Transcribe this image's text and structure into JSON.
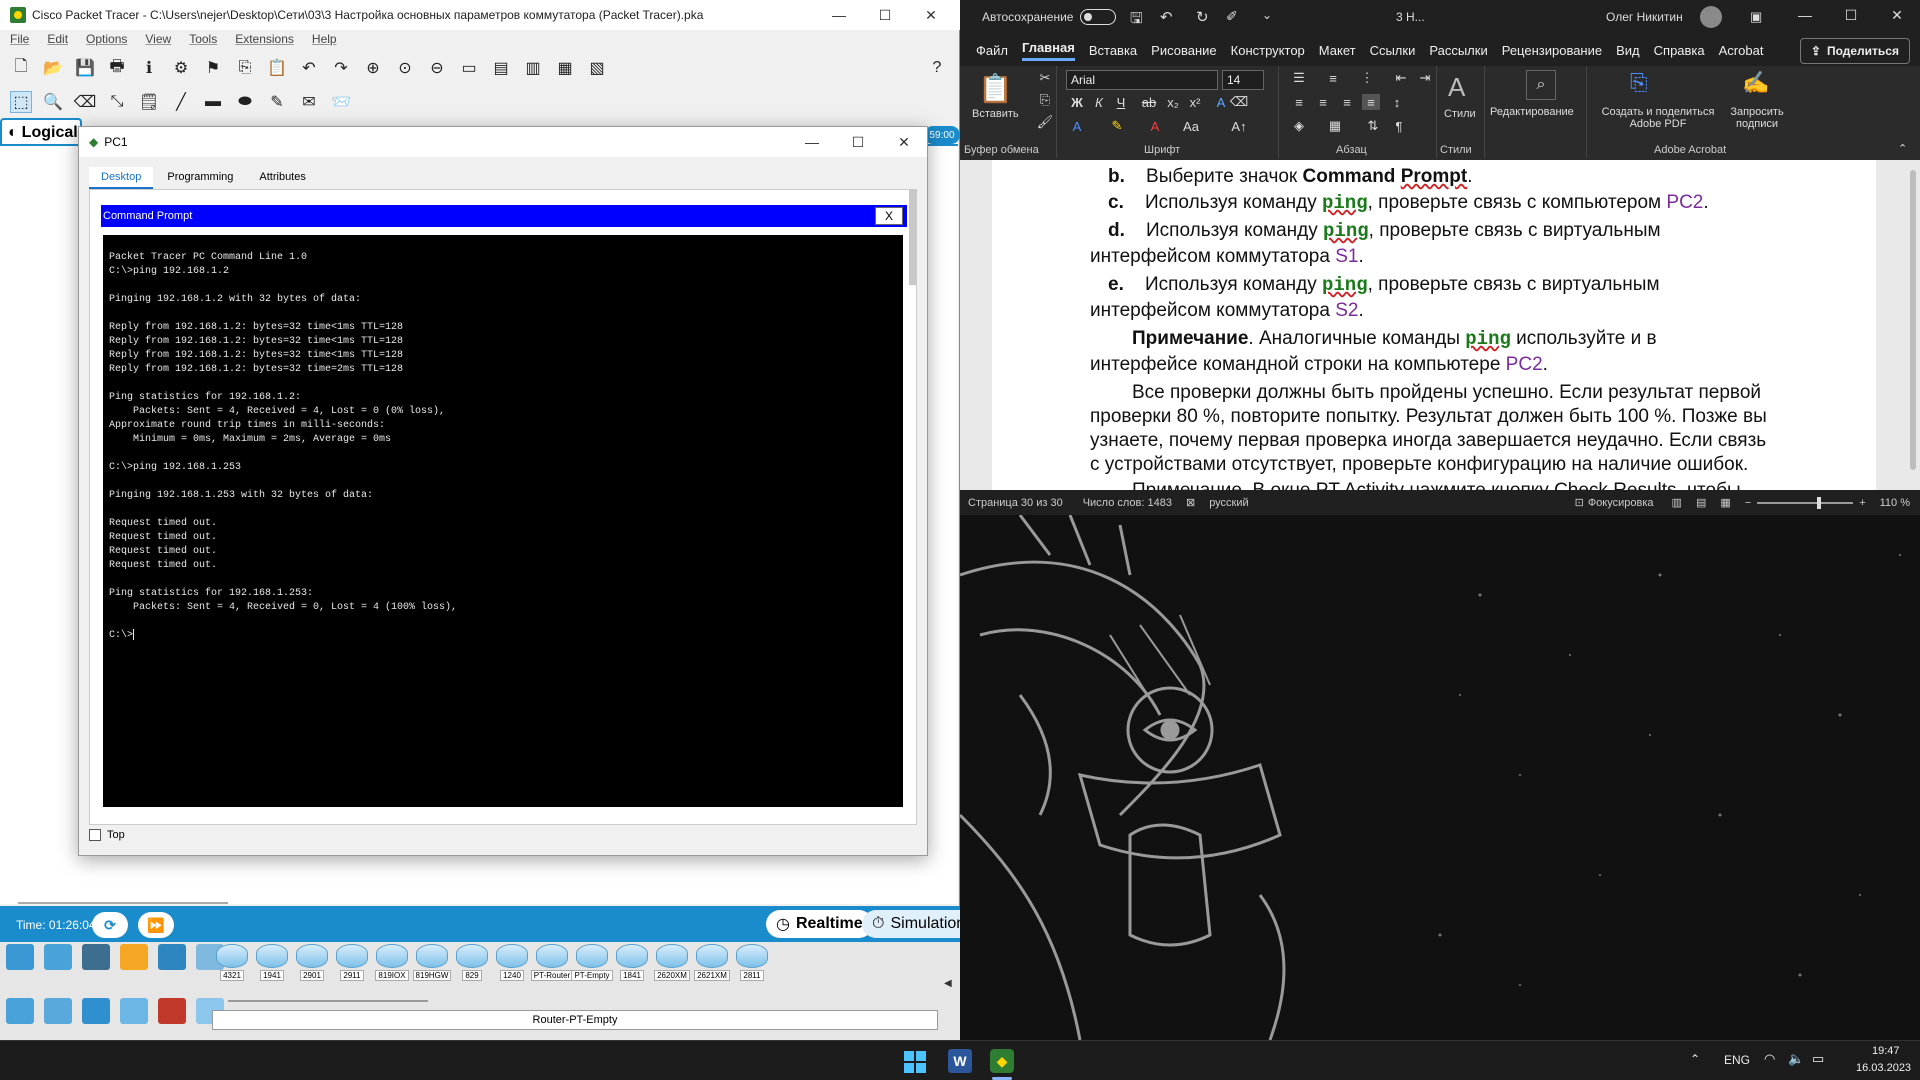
{
  "packet_tracer": {
    "window_title": "Cisco Packet Tracer - C:\\Users\\nejer\\Desktop\\Сети\\03\\3 Настройка основных параметров коммутатора (Packet Tracer).pka",
    "menu": [
      "File",
      "Edit",
      "Options",
      "View",
      "Tools",
      "Extensions",
      "Help"
    ],
    "logical_tab": "Logical",
    "top_right_time": "59:00",
    "time_label": "Time: 01:26:04",
    "realtime_label": "Realtime",
    "simulation_label": "Simulation",
    "device_models": [
      "4321",
      "1941",
      "2901",
      "2911",
      "819IOX",
      "819HGW",
      "829",
      "1240",
      "PT-Router",
      "PT-Empty",
      "1841",
      "2620XM",
      "2621XM",
      "2811"
    ],
    "selected_device": "Router-PT-Empty"
  },
  "pc1": {
    "window_title": "PC1",
    "tabs": [
      "Desktop",
      "Programming",
      "Attributes"
    ],
    "cmd_title": "Command Prompt",
    "cmd_close": "X",
    "terminal_text": "Packet Tracer PC Command Line 1.0\nC:\\>ping 192.168.1.2\n\nPinging 192.168.1.2 with 32 bytes of data:\n\nReply from 192.168.1.2: bytes=32 time<1ms TTL=128\nReply from 192.168.1.2: bytes=32 time<1ms TTL=128\nReply from 192.168.1.2: bytes=32 time<1ms TTL=128\nReply from 192.168.1.2: bytes=32 time=2ms TTL=128\n\nPing statistics for 192.168.1.2:\n    Packets: Sent = 4, Received = 4, Lost = 0 (0% loss),\nApproximate round trip times in milli-seconds:\n    Minimum = 0ms, Maximum = 2ms, Average = 0ms\n\nC:\\>ping 192.168.1.253\n\nPinging 192.168.1.253 with 32 bytes of data:\n\nRequest timed out.\nRequest timed out.\nRequest timed out.\nRequest timed out.\n\nPing statistics for 192.168.1.253:\n    Packets: Sent = 4, Received = 0, Lost = 4 (100% loss),\n\nC:\\>",
    "top_checkbox_label": "Top"
  },
  "word": {
    "autosave_label": "Автосохранение",
    "doc_name": "3 Н...",
    "user_name": "Олег Никитин",
    "tabs": [
      "Файл",
      "Главная",
      "Вставка",
      "Рисование",
      "Конструктор",
      "Макет",
      "Ссылки",
      "Рассылки",
      "Рецензирование",
      "Вид",
      "Справка",
      "Acrobat"
    ],
    "active_tab": "Главная",
    "share_label": "Поделиться",
    "ribbon": {
      "paste_label": "Вставить",
      "font_name": "Arial",
      "font_size": "14",
      "styles_label": "Стили",
      "editing_label": "Редактирование",
      "acrobat_create_label": "Создать и поделиться Adobe PDF",
      "acrobat_sign_label": "Запросить подписи",
      "groups": {
        "clipboard": "Буфер обмена",
        "font": "Шрифт",
        "paragraph": "Абзац",
        "styles": "Стили",
        "acrobat": "Adobe Acrobat"
      }
    },
    "doc": {
      "b_marker": "b.",
      "b_text_pre": "Выберите значок ",
      "b_text_bold1": "Command ",
      "b_text_bold2": "Prompt",
      "b_text_post": ".",
      "c_marker": "c.",
      "c_pre": "Используя команду ",
      "ping": "ping",
      "c_mid": ", проверьте связь с компьютером ",
      "c_term": "PC2",
      "c_post": ".",
      "d_marker": "d.",
      "d_pre": "Используя команду ",
      "d_mid": ", проверьте связь с виртуальным",
      "d_line2": "интерфейсом коммутатора ",
      "d_term": "S1",
      "d_post": ".",
      "e_marker": "e.",
      "e_pre": "Используя команду ",
      "e_mid": ", проверьте связь с виртуальным",
      "e_line2": "интерфейсом коммутатора ",
      "e_term": "S2",
      "e_post": ".",
      "note_label": "Примечание",
      "note_text": ". Аналогичные команды ",
      "note_text2": " используйте и в",
      "note_line2": "интерфейсе командной строки на компьютере ",
      "note_term": "PC2",
      "note_post": ".",
      "para_line1": "Все проверки должны быть пройдены успешно. Если результат первой",
      "para_line2": "проверки 80 %, повторите попытку. Результат должен быть 100 %. Позже вы",
      "para_line3": "узнаете, почему первая проверка иногда завершается неудачно. Если связь",
      "para_line4": "с устройствами отсутствует, проверьте конфигурацию на наличие ошибок.",
      "cut_line": "Примечание. В окне PT Activity нажмите кнопку Check Results, чтобы"
    },
    "status": {
      "page": "Страница 30 из 30",
      "words": "Число слов: 1483",
      "language": "русский",
      "focus": "Фокусировка",
      "zoom": "110 %"
    }
  },
  "taskbar": {
    "lang": "ENG",
    "time": "19:47",
    "date": "16.03.2023"
  }
}
